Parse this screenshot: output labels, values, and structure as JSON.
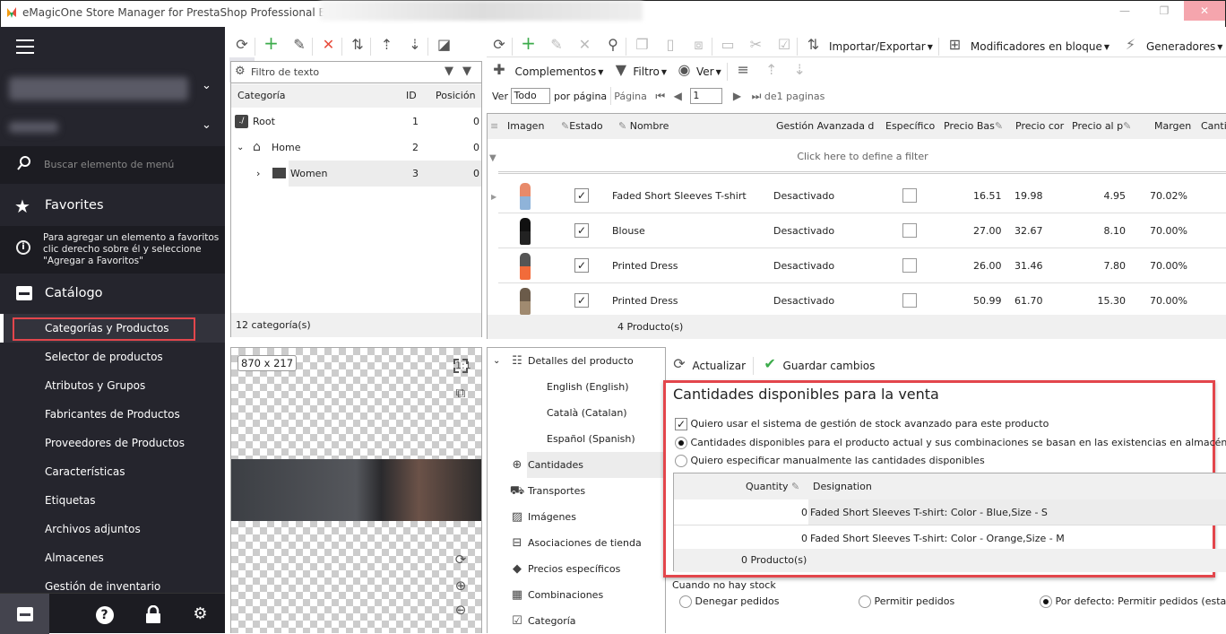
{
  "window": {
    "title": "eMagicOne Store Manager for PrestaShop Professional Edition",
    "controls": {
      "minimize": "—",
      "maximize": "❐",
      "close": "✕"
    }
  },
  "sidebar": {
    "search_placeholder": "Buscar elemento de menú",
    "favorites_label": "Favorites",
    "favorites_hint": "Para agregar un elemento a favoritos clic derecho sobre él y seleccione \"Agregar a Favoritos\"",
    "catalog_label": "Catálogo",
    "items": [
      {
        "label": "Categorías y Productos",
        "active": true
      },
      {
        "label": "Selector de productos"
      },
      {
        "label": "Atributos y Grupos"
      },
      {
        "label": "Fabricantes de Productos"
      },
      {
        "label": "Proveedores de Productos"
      },
      {
        "label": "Características"
      },
      {
        "label": "Etiquetas"
      },
      {
        "label": "Archivos adjuntos"
      },
      {
        "label": "Almacenes"
      },
      {
        "label": "Gestión de inventario"
      }
    ],
    "accent": "#e3464c"
  },
  "categories": {
    "filter_placeholder": "Filtro de texto",
    "columns": [
      "Categoría",
      "ID",
      "Posición"
    ],
    "rows": [
      {
        "name": "Root",
        "id": "1",
        "position": "0"
      },
      {
        "name": "Home",
        "id": "2",
        "position": "0"
      },
      {
        "name": "Women",
        "id": "3",
        "position": "0"
      }
    ],
    "footer": "12 categoría(s)"
  },
  "image_preview": {
    "size": "870 x 217"
  },
  "products": {
    "toolbar": {
      "import_export": "Importar/Exportar",
      "bulk_modifiers": "Modificadores en bloque",
      "generators": "Generadores",
      "addons": "Complementos",
      "filter": "Filtro",
      "view": "Ver"
    },
    "pager": {
      "view_label": "Ver",
      "per_page_value": "Todo",
      "per_page_label": "por página",
      "page_label": "Página",
      "page_value": "1",
      "of_pages": "de1 paginas"
    },
    "columns": [
      "Imagen",
      "Estado",
      "Nombre",
      "Gestión Avanzada de",
      "Específico",
      "Precio Bas",
      "Precio cor",
      "Precio al p",
      "Margen",
      "Canti"
    ],
    "filter_hint": "Click here to define a filter",
    "rows": [
      {
        "name": "Faded Short Sleeves T-shirt",
        "status": true,
        "advanced": "Desactivado",
        "specific": false,
        "base_price": "16.51",
        "price_tax": "19.98",
        "wholesale": "4.95",
        "margin": "70.02%"
      },
      {
        "name": "Blouse",
        "status": true,
        "advanced": "Desactivado",
        "specific": false,
        "base_price": "27.00",
        "price_tax": "32.67",
        "wholesale": "8.10",
        "margin": "70.00%"
      },
      {
        "name": "Printed Dress",
        "status": true,
        "advanced": "Desactivado",
        "specific": false,
        "base_price": "26.00",
        "price_tax": "31.46",
        "wholesale": "7.80",
        "margin": "70.00%"
      },
      {
        "name": "Printed Dress",
        "status": true,
        "advanced": "Desactivado",
        "specific": false,
        "base_price": "50.99",
        "price_tax": "61.70",
        "wholesale": "15.30",
        "margin": "70.00%"
      }
    ],
    "footer": "4 Producto(s)"
  },
  "details_tree": {
    "items": [
      {
        "label": "Detalles del producto",
        "icon": "list-icon"
      },
      {
        "label": "English (English)"
      },
      {
        "label": "Català (Catalan)"
      },
      {
        "label": "Español (Spanish)"
      },
      {
        "label": "Cantidades",
        "icon": "plus-minus-icon",
        "selected": true
      },
      {
        "label": "Transportes",
        "icon": "truck-icon"
      },
      {
        "label": "Imágenes",
        "icon": "image-icon"
      },
      {
        "label": "Asociaciones de tienda",
        "icon": "store-icon"
      },
      {
        "label": "Precios específicos",
        "icon": "tag-icon"
      },
      {
        "label": "Combinaciones",
        "icon": "grid-icon"
      },
      {
        "label": "Categoría",
        "icon": "folder-check-icon"
      }
    ]
  },
  "quantities": {
    "refresh": "Actualizar",
    "save": "Guardar cambios",
    "title": "Cantidades disponibles para la venta",
    "advanced_stock_checkbox": "Quiero usar el sistema de gestión de stock avanzado para este producto",
    "option_warehouse": "Cantidades disponibles para el producto actual y sus combinaciones se basan en las existencias en almacén",
    "option_manual": "Quiero especificar manualmente las cantidades disponibles",
    "columns": [
      "Quantity",
      "Designation"
    ],
    "rows": [
      {
        "quantity": "0",
        "designation": "Faded Short Sleeves T-shirt: Color - Blue,Size - S"
      },
      {
        "quantity": "0",
        "designation": "Faded Short Sleeves T-shirt: Color - Orange,Size - M"
      }
    ],
    "footer": "0 Producto(s)"
  },
  "out_of_stock": {
    "label": "Cuando no hay stock",
    "options": [
      "Denegar pedidos",
      "Permitir pedidos",
      "Por defecto: Permitir pedidos (estab"
    ],
    "selected": 2
  }
}
